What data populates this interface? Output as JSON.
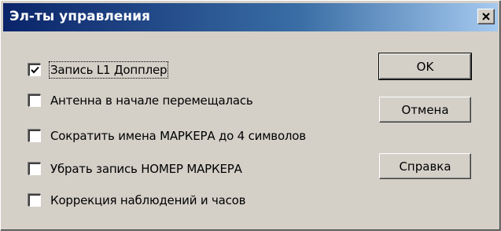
{
  "window": {
    "title": "Эл-ты управления",
    "close_icon": "close-icon"
  },
  "options": [
    {
      "label": "Запись L1 Допплер",
      "checked": true
    },
    {
      "label": "Антенна в начале перемещалась",
      "checked": false
    },
    {
      "label": "Сократить имена МАРКЕРА до 4 символов",
      "checked": false
    },
    {
      "label": "Убрать запись НОМЕР МАРКЕРА",
      "checked": false
    },
    {
      "label": "Коррекция наблюдений и часов",
      "checked": false
    }
  ],
  "buttons": {
    "ok_label": "OK",
    "cancel_label": "Отмена",
    "help_label": "Справка"
  },
  "colors": {
    "titlebar_start": "#0a246a",
    "titlebar_end": "#a6caf0",
    "face": "#d4d0c8"
  }
}
